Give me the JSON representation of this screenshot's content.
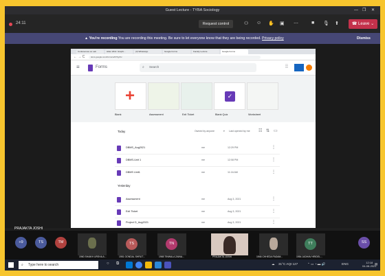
{
  "window": {
    "title": "Guest Lecture - TYBA Sociology"
  },
  "meeting": {
    "timer": "24:11",
    "request_control": "Request control",
    "leave": "Leave"
  },
  "banner": {
    "bold": "You're recording",
    "text": " You are recording this meeting. Be sure to let everyone know that they are being recorded.",
    "link": "Privacy policy",
    "dismiss": "Dismiss"
  },
  "browser": {
    "tabs": [
      "Conferences on Lab",
      "Hitler 2011: Graphi...",
      "(3) WhatsApp",
      "Google Forms",
      "Faculty Lecture",
      "Google Forms"
    ],
    "url": "docs.google.com/forms/u/0/?tgif=c"
  },
  "forms": {
    "app_title": "Forms",
    "search_placeholder": "Search",
    "templates": [
      "Blank",
      "Assessment",
      "Exit Ticket",
      "Blank Quiz",
      "Worksheet"
    ],
    "list_header": {
      "section_today": "Today",
      "owner": "Owned by anyone",
      "sort": "Last opened by me"
    },
    "today": [
      {
        "name": "DBMS_Aug2021",
        "owner": "me",
        "date": "12:29 PM"
      },
      {
        "name": "DBMS-Unit 1",
        "owner": "me",
        "date": "12:08 PM"
      },
      {
        "name": "DBMS Unit1",
        "owner": "me",
        "date": "11:16 AM"
      }
    ],
    "section_yesterday": "Yesterday",
    "yesterday": [
      {
        "name": "Assessment",
        "owner": "me",
        "date": "Aug 3, 2021"
      },
      {
        "name": "Exit Ticket",
        "owner": "me",
        "date": "Aug 3, 2021"
      },
      {
        "name": "Project D_Aug2021",
        "owner": "me",
        "date": "Aug 3, 2021"
      }
    ]
  },
  "presenter": "PRAJAKTA JOSHI",
  "participants": {
    "more": "+9",
    "avatars": [
      {
        "initials": "TS",
        "color": "#4a5a9c"
      },
      {
        "initials": "TM",
        "color": "#b0413e"
      },
      {
        "initials": "TS",
        "color": "#b85a5a"
      },
      {
        "initials": "TN",
        "color": "#b23a6d"
      },
      {
        "initials": "TT",
        "color": "#3f7e5c"
      },
      {
        "initials": "SS",
        "color": "#6a4ea8"
      }
    ],
    "names": [
      "1960 SHAIKH URSHA A...",
      "1951 GONDAL SHRUT...",
      "1965 TINWALA ZAINA...",
      "PRAJAKTA JOSHI",
      "1946 CHHEDA PADAM...",
      "1954 JADHAV HRIDEL..."
    ]
  },
  "taskbar": {
    "search_placeholder": "Type here to search",
    "weather": "31°C AQI 127",
    "lang": "ENG",
    "time": "12:18",
    "date": "04-08-2021"
  }
}
